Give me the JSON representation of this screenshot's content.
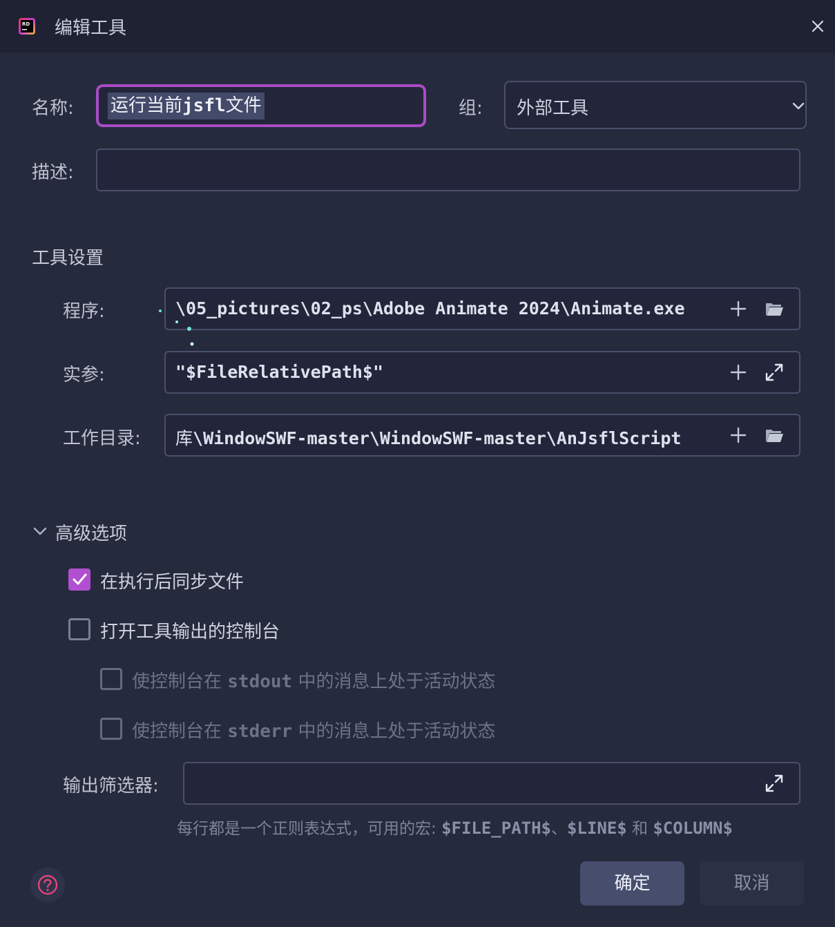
{
  "window": {
    "title": "编辑工具",
    "close_glyph": "✕"
  },
  "form": {
    "name_label": "名称:",
    "name_value_prefix": "运行当前",
    "name_value_mono": "jsfl",
    "name_value_suffix": "文件",
    "group_label": "组:",
    "group_value": "外部工具",
    "desc_label": "描述:",
    "desc_value": ""
  },
  "tool_settings": {
    "title": "工具设置",
    "program_label": "程序:",
    "program_value": "\\05_pictures\\02_ps\\Adobe Animate 2024\\Animate.exe",
    "args_label": "实参:",
    "args_value": "\"$FileRelativePath$\"",
    "workdir_label": "工作目录:",
    "workdir_value_cjk": "库",
    "workdir_value": "\\WindowSWF-master\\WindowSWF-master\\AnJsflScript"
  },
  "advanced": {
    "title": "高级选项",
    "sync_files": {
      "label": "在执行后同步文件",
      "checked": true
    },
    "open_console": {
      "label": "打开工具输出的控制台",
      "checked": false
    },
    "stdout_prefix": "使控制台在",
    "stdout_mono": "stdout",
    "stdout_suffix": "中的消息上处于活动状态",
    "stderr_prefix": "使控制台在",
    "stderr_mono": "stderr",
    "stderr_suffix": "中的消息上处于活动状态",
    "filter_label": "输出筛选器:",
    "filter_value": "",
    "hint_prefix": "每行都是一个正则表达式，可用的宏:",
    "hint_macro1": "$FILE_PATH$",
    "hint_sep1": "、",
    "hint_macro2": "$LINE$",
    "hint_and": "和",
    "hint_macro3": "$COLUMN$"
  },
  "buttons": {
    "ok": "确定",
    "cancel": "取消"
  },
  "colors": {
    "accent": "#b24fd0",
    "focus_border": "#a94cc6",
    "background": "#262a3d",
    "titlebar": "#1f2233"
  }
}
